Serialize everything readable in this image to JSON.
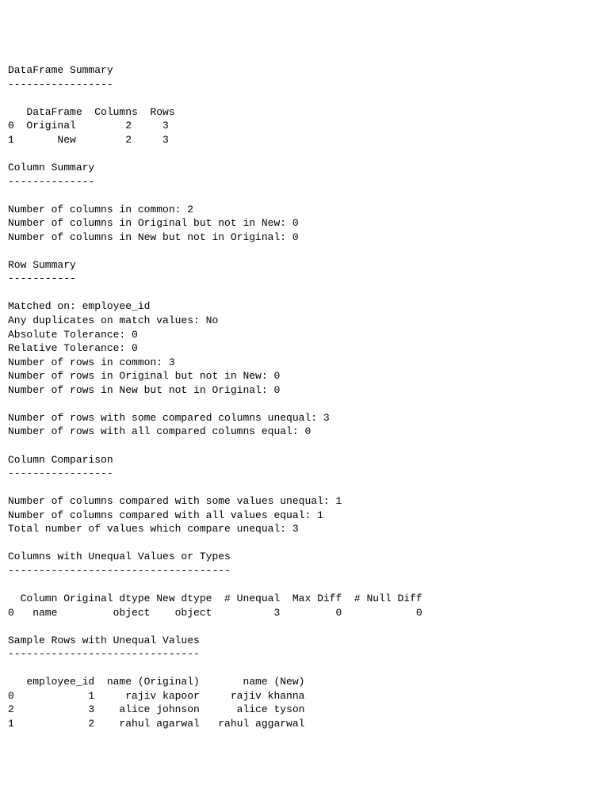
{
  "sections": {
    "dataframe_summary": {
      "title": "DataFrame Summary",
      "underline": "-----------------",
      "table": {
        "header": "   DataFrame  Columns  Rows",
        "rows": [
          "0  Original        2     3",
          "1       New        2     3"
        ]
      }
    },
    "column_summary": {
      "title": "Column Summary",
      "underline": "--------------",
      "lines": [
        "Number of columns in common: 2",
        "Number of columns in Original but not in New: 0",
        "Number of columns in New but not in Original: 0"
      ]
    },
    "row_summary": {
      "title": "Row Summary",
      "underline": "-----------",
      "block1": [
        "Matched on: employee_id",
        "Any duplicates on match values: No",
        "Absolute Tolerance: 0",
        "Relative Tolerance: 0",
        "Number of rows in common: 3",
        "Number of rows in Original but not in New: 0",
        "Number of rows in New but not in Original: 0"
      ],
      "block2": [
        "Number of rows with some compared columns unequal: 3",
        "Number of rows with all compared columns equal: 0"
      ]
    },
    "column_comparison": {
      "title": "Column Comparison",
      "underline": "-----------------",
      "lines": [
        "Number of columns compared with some values unequal: 1",
        "Number of columns compared with all values equal: 1",
        "Total number of values which compare unequal: 3"
      ]
    },
    "unequal_cols": {
      "title": "Columns with Unequal Values or Types",
      "underline": "------------------------------------",
      "table": {
        "header": "  Column Original dtype New dtype  # Unequal  Max Diff  # Null Diff",
        "rows": [
          "0   name         object    object          3         0            0"
        ]
      }
    },
    "sample_rows": {
      "title": "Sample Rows with Unequal Values",
      "underline": "-------------------------------",
      "table": {
        "header": "   employee_id  name (Original)       name (New)",
        "rows": [
          "0            1     rajiv kapoor     rajiv khanna",
          "2            3    alice johnson      alice tyson",
          "1            2    rahul agarwal   rahul aggarwal"
        ]
      }
    }
  }
}
